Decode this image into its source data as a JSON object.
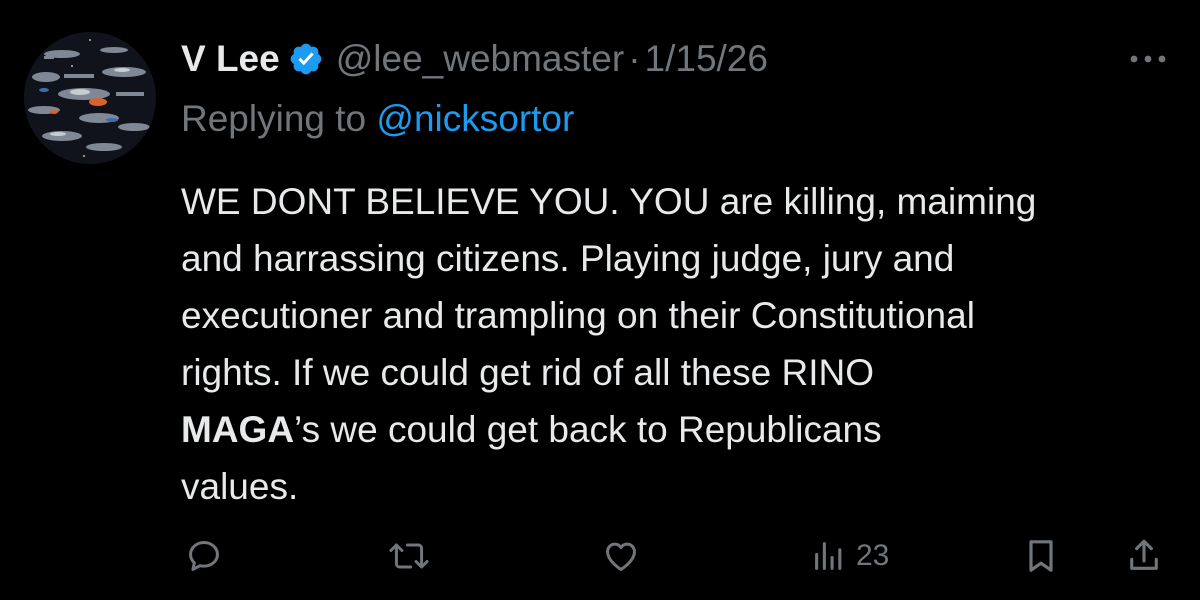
{
  "tweet": {
    "author": {
      "display_name": "V Lee",
      "handle": "@lee_webmaster",
      "verified": true,
      "avatar": "starships-collage-avatar"
    },
    "separator": "·",
    "date": "1/15/26",
    "reply": {
      "prefix": "Replying to ",
      "mention": "@nicksortor"
    },
    "body": {
      "line1": "WE DONT BELIEVE YOU. YOU are killing, maiming",
      "line2": "and harrassing citizens. Playing judge, jury and",
      "line3": "executioner and trampling on their Constitutional",
      "line4": "rights. If we could get rid of all these RINO",
      "line5_bold": "MAGA",
      "line5_rest": "’s we could get back to Republicans",
      "line6": "values."
    },
    "actions": {
      "reply_icon": "reply-icon",
      "repost_icon": "repost-icon",
      "like_icon": "heart-icon",
      "views_icon": "analytics-icon",
      "views_count": "23",
      "bookmark_icon": "bookmark-icon",
      "share_icon": "share-icon"
    },
    "more_icon": "more-icon"
  },
  "colors": {
    "background": "#000000",
    "text": "#e7e9ea",
    "muted": "#71767b",
    "accent": "#1d9bf0"
  }
}
